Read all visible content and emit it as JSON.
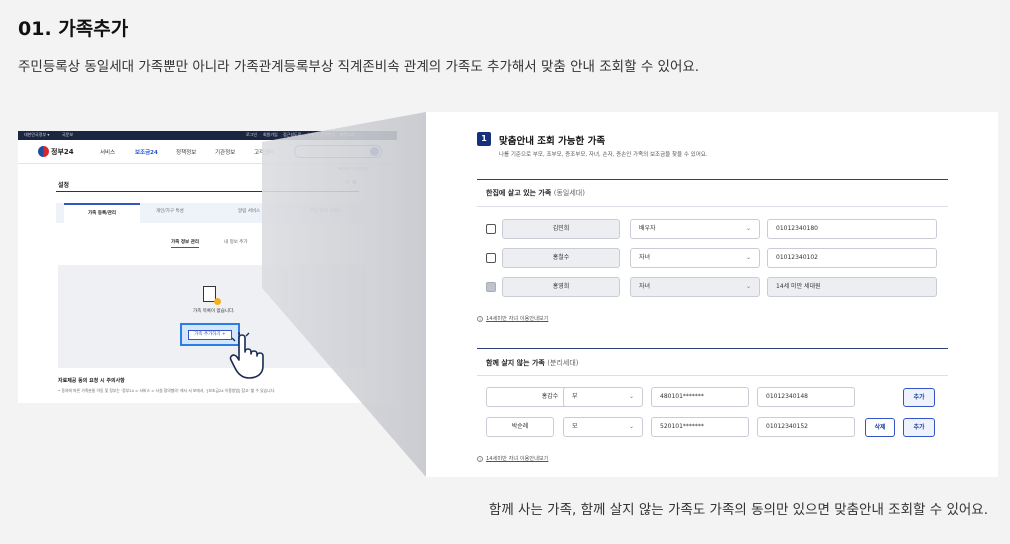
{
  "heading": "01. 가족추가",
  "subheading": "주민등록상 동일세대 가족뿐만 아니라 가족관계등록부상 직계존비속 관계의 가족도 추가해서 맞춤 안내 조회할 수 있어요.",
  "caption": "함께 사는 가족, 함께 살지 않는 가족도 가족의 동의만 있으면 맞춤안내 조회할 수 있어요.",
  "screenshot": {
    "utility_items": [
      "대한민국정부 ▾",
      "국문보",
      "로그인",
      "회원가입",
      "접근성도움",
      "누리집 연결안내",
      "화면크기"
    ],
    "logo": "정부24",
    "menu": [
      "서비스",
      "보조금24",
      "정책정보",
      "기관정보",
      "고객센터"
    ],
    "breadcrumb": "Home  ›  나의정보",
    "page_title": "설정",
    "tabs": [
      "가족 등록/관리",
      "개인/가구 특성",
      "알림 서비스",
      "관심 등록 서비스"
    ],
    "subtabs": [
      "가족 정보 관리",
      "내 정보 추가"
    ],
    "empty_message": "가족 목록이 없습니다.",
    "add_button": "가족 추가하기 +",
    "notes_title": "자료제공 동의 요청 시 주의사항",
    "notes_body": "• 동의에 따른 가족분들 이동 및 정부는 '정부24 > 서비스 > 사실 정의형의' 에서 서 보에서, '[보조금24 이용방법] 참고' 할 수 있습니다."
  },
  "panel": {
    "step_number": "1",
    "step_title": "맞춤안내 조회 가능한 가족",
    "step_desc": "나를 기준으로 부모, 조부모, 증조부모, 자녀, 손자, 증손인 가족의 보조금을 찾을 수 있어요.",
    "section1": {
      "title": "한집에 살고 있는 가족",
      "subtitle": "(동일세대)",
      "rows": [
        {
          "name": "김민희",
          "relation": "배우자",
          "contact": "01012340180",
          "disabled": false
        },
        {
          "name": "홍철수",
          "relation": "자녀",
          "contact": "01012340102",
          "disabled": false
        },
        {
          "name": "홍영희",
          "relation": "자녀",
          "contact": "14세 미만 세대원",
          "disabled": true
        }
      ],
      "info_link": "14세미만 자녀 이용안내보기"
    },
    "section2": {
      "title": "함께 살지 않는 가족",
      "subtitle": "(분리세대)",
      "rows": [
        {
          "name": "홍갑수",
          "relation": "부",
          "rrn": "480101*******",
          "contact": "01012340148",
          "add": "추가"
        },
        {
          "name": "박순례",
          "relation": "모",
          "rrn": "520101*******",
          "contact": "01012340152",
          "delete": "삭제",
          "add": "추가"
        }
      ],
      "info_link": "14세미만 자녀 이용안내보기"
    },
    "chevron": "⌄",
    "info_icon": "i"
  }
}
